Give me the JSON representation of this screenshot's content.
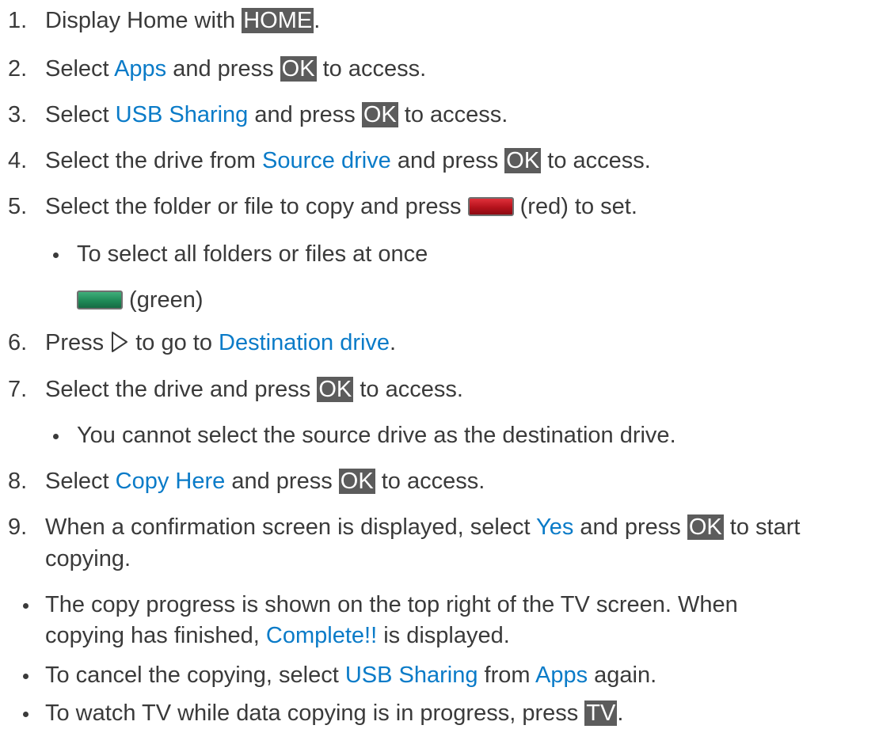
{
  "steps": {
    "s1": {
      "num": "1.",
      "pre": "Display Home with ",
      "key": "HOME",
      "post": "."
    },
    "s2": {
      "num": "2.",
      "pre": "Select ",
      "link": "Apps",
      "mid": " and press ",
      "key": "OK",
      "post": " to access."
    },
    "s3": {
      "num": "3.",
      "pre": "Select ",
      "link": "USB Sharing",
      "mid": " and press ",
      "key": "OK",
      "post": " to access."
    },
    "s4": {
      "num": "4.",
      "pre": "Select the drive from ",
      "link": "Source drive",
      "mid": " and press ",
      "key": "OK",
      "post": " to access."
    },
    "s5": {
      "num": "5.",
      "pre": "Select the folder or file to copy and press ",
      "post": " (red) to set."
    },
    "s5_bullet": "To select all folders or files at once",
    "s5_green": " (green)",
    "s6": {
      "num": "6.",
      "pre": "Press ",
      "mid": " to go to ",
      "link": "Destination drive",
      "post": "."
    },
    "s7": {
      "num": "7.",
      "pre": "Select the drive and press ",
      "key": "OK",
      "post": " to access."
    },
    "s7_bullet": "You cannot select the source drive as the destination drive.",
    "s8": {
      "num": "8.",
      "pre": "Select ",
      "link": "Copy Here",
      "mid": " and press ",
      "key": "OK",
      "post": " to access."
    },
    "s9": {
      "num": "9.",
      "pre": "When a confirmation screen is displayed, select ",
      "link": "Yes",
      "mid": " and press ",
      "key": "OK",
      "post": " to start",
      "line2": "copying."
    }
  },
  "notes": {
    "n1": {
      "line1": "The copy progress is shown on the top right of the TV screen. When",
      "pre2": "copying has finished, ",
      "link": "Complete!!",
      "post2": " is displayed."
    },
    "n2": {
      "pre": "To cancel the copying, select ",
      "link1": "USB Sharing",
      "mid": " from ",
      "link2": "Apps",
      "post": " again."
    },
    "n3": {
      "pre": "To watch TV while data copying is in progress, press ",
      "key": "TV",
      "post": "."
    }
  }
}
